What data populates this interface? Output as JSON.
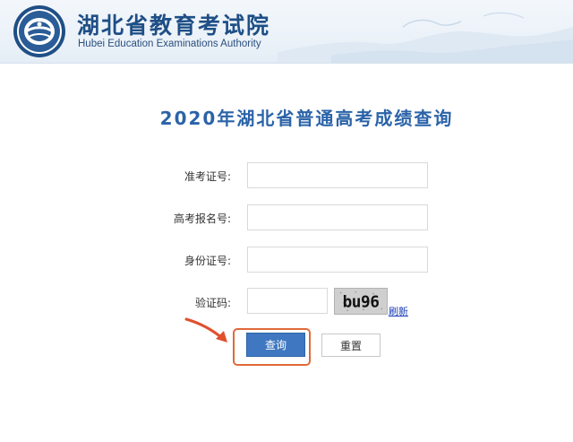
{
  "header": {
    "org_name_cn": "湖北省教育考试院",
    "org_name_en": "Hubei Education Examinations Authority",
    "logo_icon": "hubei-exam-authority-logo",
    "colors": {
      "title_blue": "#1e4f86",
      "header_bg": "#eaf1f8"
    }
  },
  "page": {
    "title": "2020年湖北省普通高考成绩查询",
    "title_color": "#2b63a8"
  },
  "form": {
    "admission_ticket_label": "准考证号:",
    "admission_ticket_value": "",
    "registration_no_label": "高考报名号:",
    "registration_no_value": "",
    "id_number_label": "身份证号:",
    "id_number_value": "",
    "captcha_label": "验证码:",
    "captcha_value": "",
    "captcha_image_text": "bu96",
    "refresh_label": "刷新",
    "query_label": "查询",
    "reset_label": "重置"
  },
  "annotation": {
    "arrow_icon": "red-arrow-icon",
    "highlight_color": "#e06a3a"
  }
}
